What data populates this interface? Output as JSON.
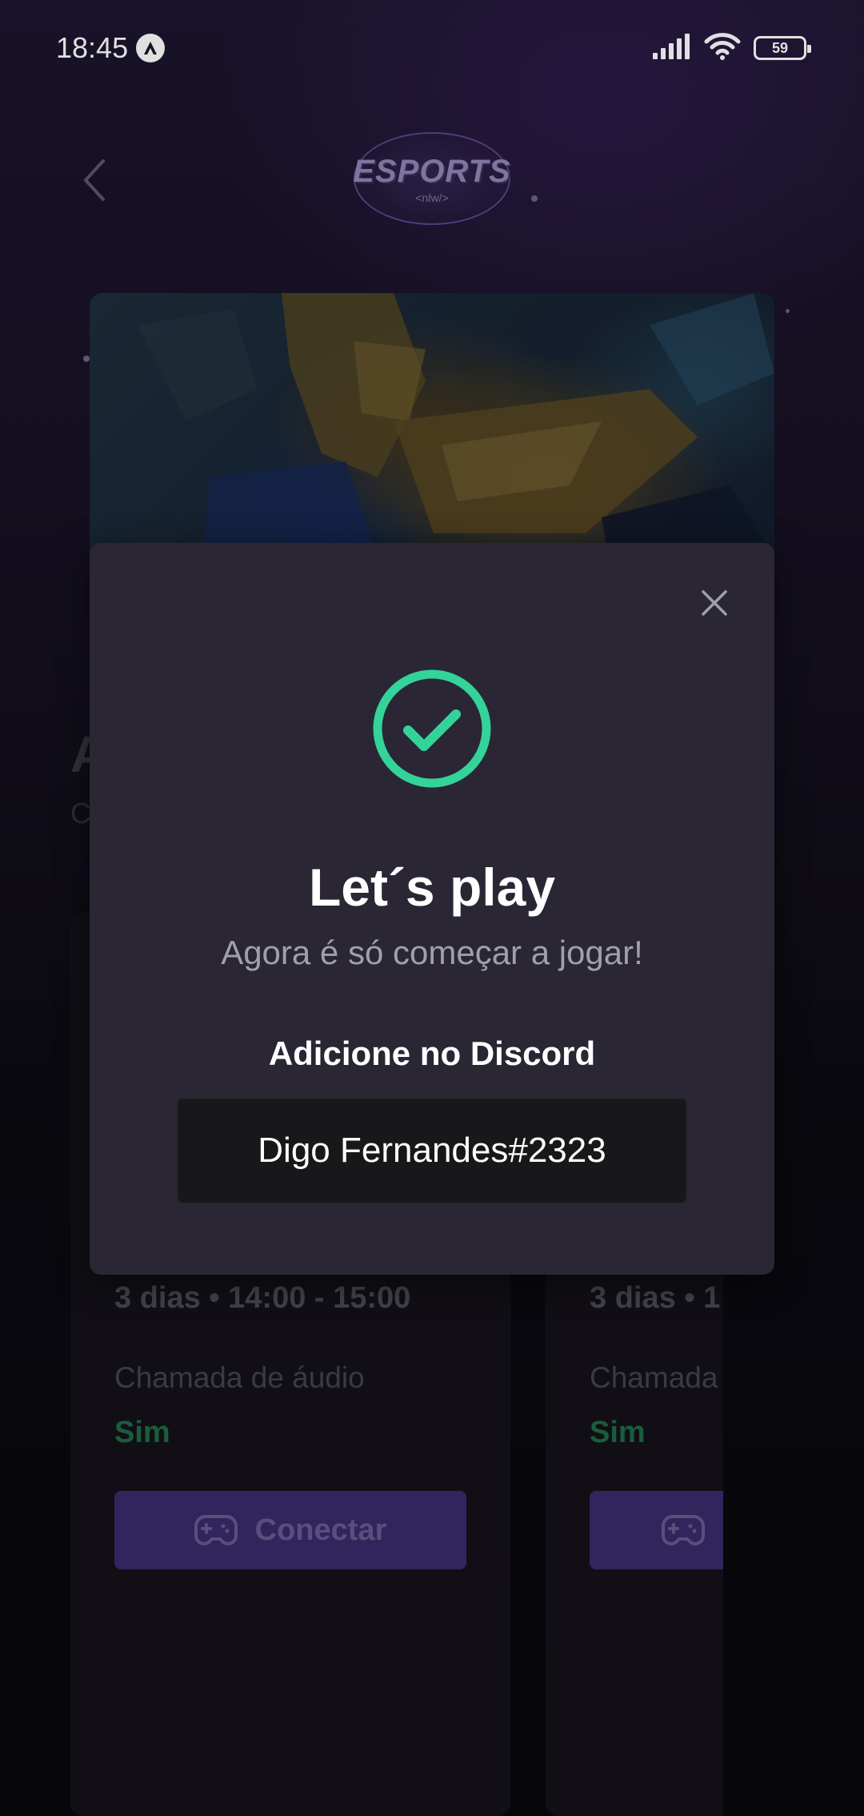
{
  "status_bar": {
    "time": "18:45",
    "battery": "59",
    "icons": [
      "app-notification-icon",
      "signal-icon",
      "wifi-icon",
      "battery-icon"
    ]
  },
  "header": {
    "logo_title": "ESPORTS",
    "logo_subtitle": "<nlw/>",
    "back_icon": "chevron-left-icon"
  },
  "background_page": {
    "heading_partial": "A",
    "subheading_partial": "C",
    "cards": [
      {
        "days_time": "3 dias • 14:00 - 15:00",
        "voice_label": "Chamada de áudio",
        "voice_value": "Sim",
        "connect_label": "Conectar"
      },
      {
        "days_time": "3 dias • 1",
        "voice_label": "Chamada",
        "voice_value": "Sim",
        "connect_label": ""
      }
    ]
  },
  "modal": {
    "title": "Let´s play",
    "subtitle": "Agora é só começar a jogar!",
    "discord_label": "Adicione no Discord",
    "discord_user": "Digo Fernandes#2323",
    "close_icon": "close-icon",
    "success_icon": "check-circle-icon"
  },
  "colors": {
    "accent_purple": "#8B5CF6",
    "success_green": "#34D399",
    "modal_bg": "#2A2634",
    "field_bg": "#18181B"
  }
}
